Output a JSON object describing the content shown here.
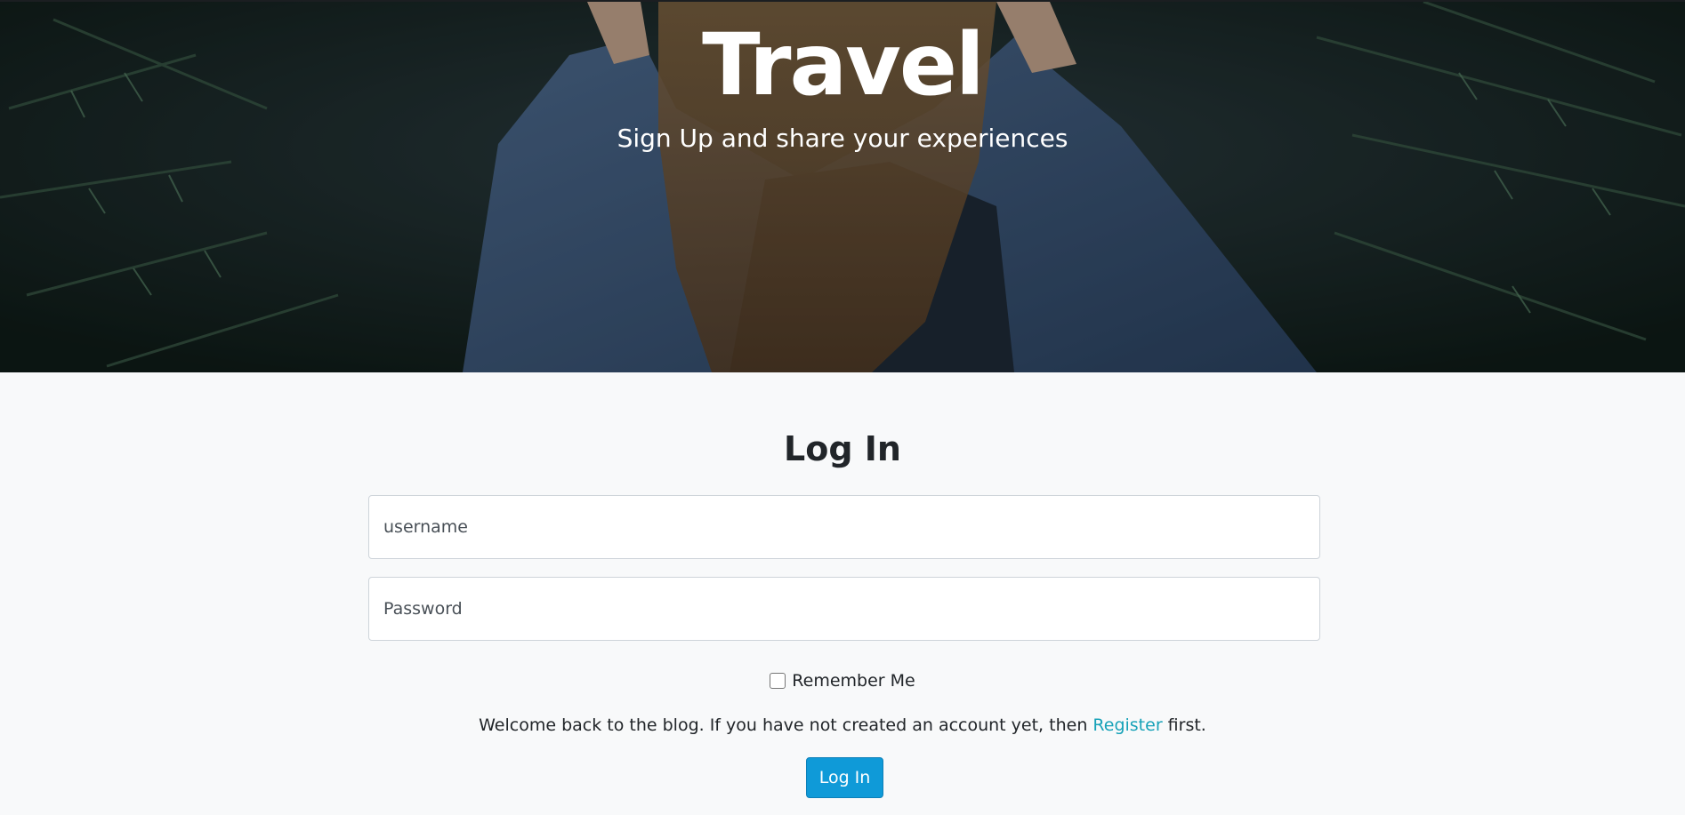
{
  "hero": {
    "title": "Travel",
    "subtitle": "Sign Up and share your experiences"
  },
  "login": {
    "heading": "Log In",
    "username_placeholder": "username",
    "password_placeholder": "Password",
    "remember_label": "Remember Me",
    "remember_checked": false,
    "welcome_before": "Welcome back to the blog. If you have not created an account yet, then ",
    "register_link": "Register",
    "welcome_after": " first.",
    "submit_label": "Log In"
  },
  "colors": {
    "accent": "#0f9ad8",
    "link": "#17a2b8",
    "page_background": "#f8f9fa",
    "text": "#212529"
  }
}
